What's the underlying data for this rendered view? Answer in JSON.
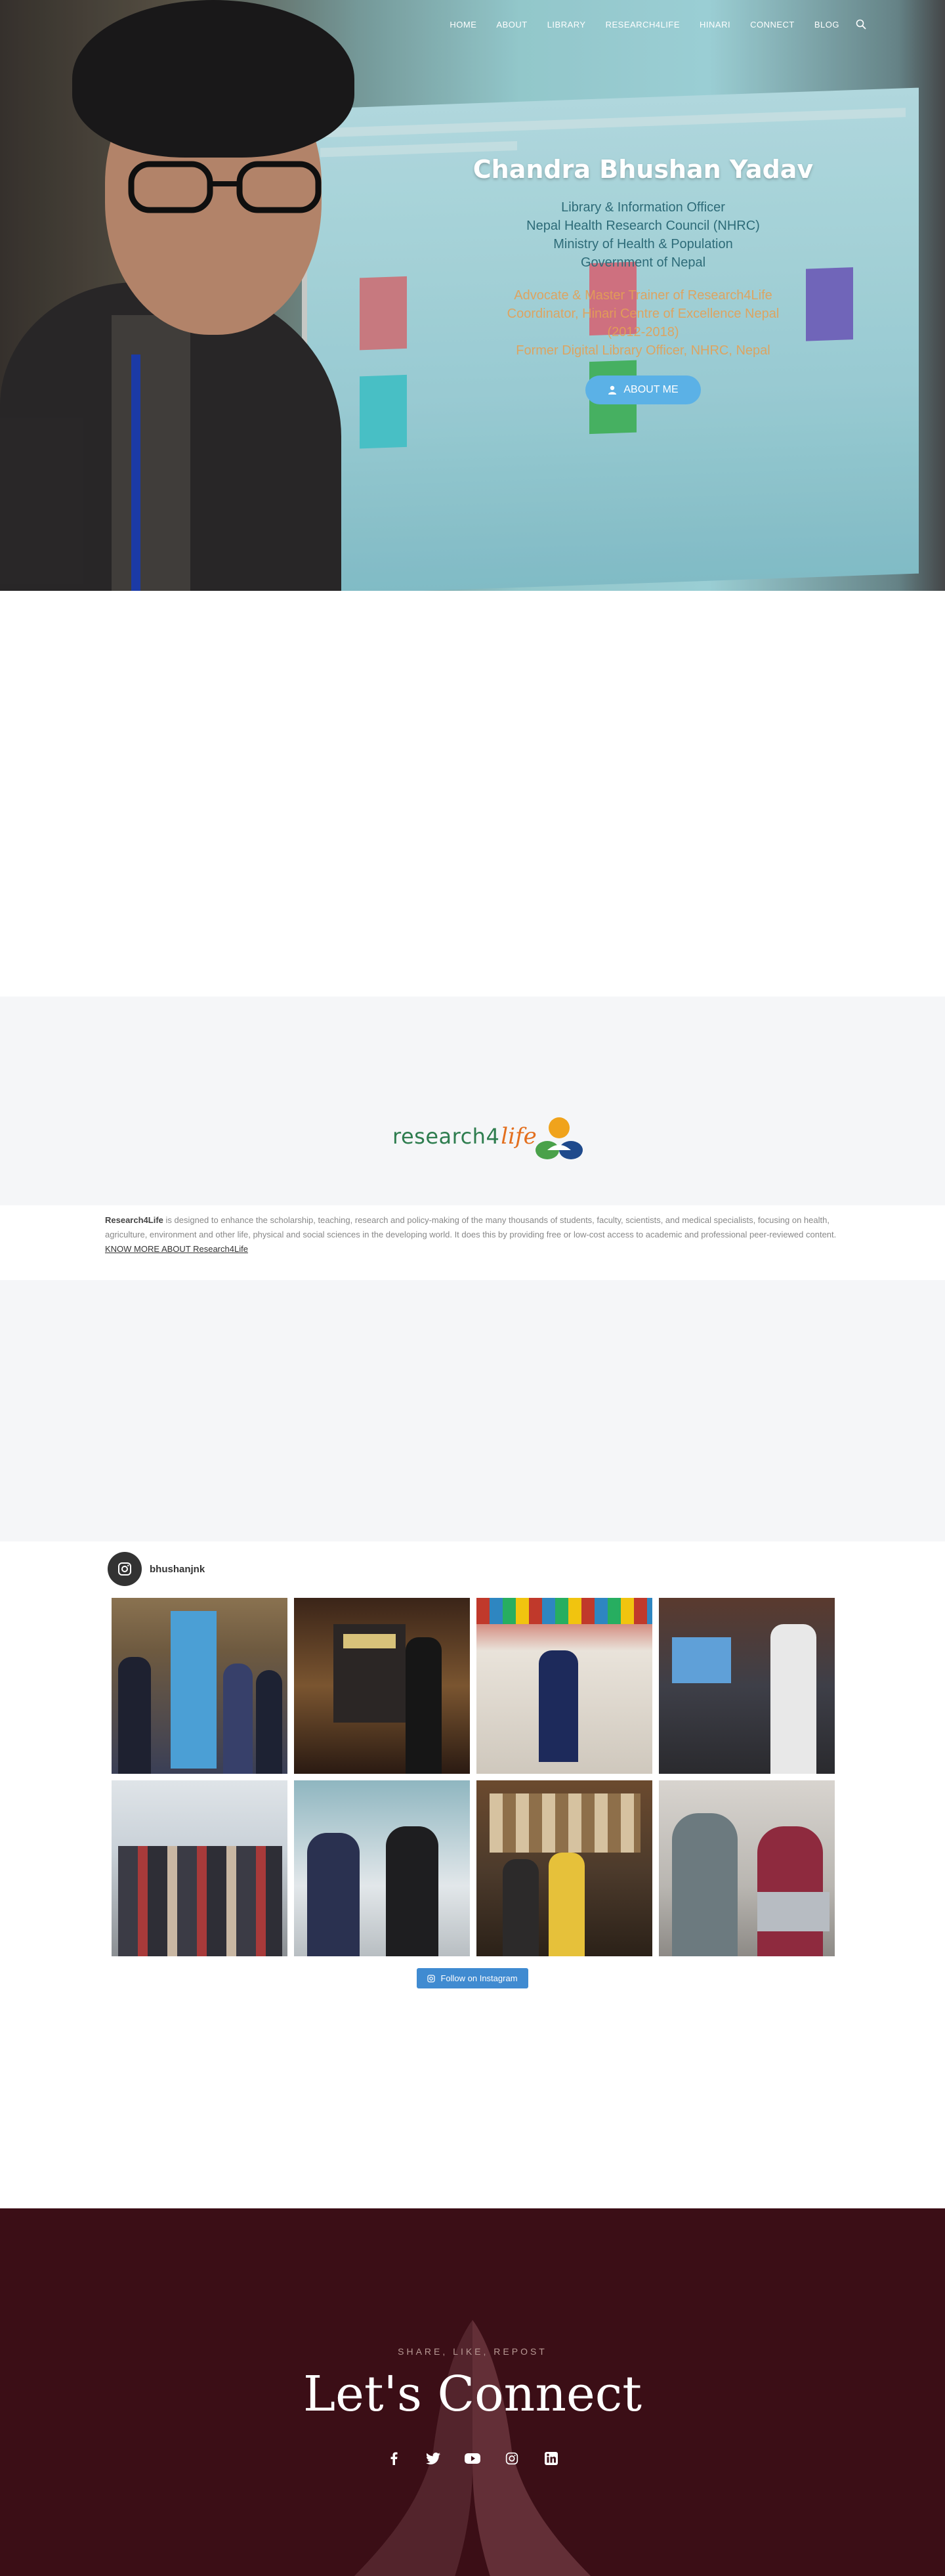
{
  "nav": {
    "items": [
      "HOME",
      "ABOUT",
      "LIBRARY",
      "RESEARCH4LIFE",
      "HINARI",
      "CONNECT",
      "BLOG"
    ]
  },
  "hero": {
    "name": "Chandra Bhushan Yadav",
    "lines": [
      "Library & Information Officer",
      "Nepal Health Research Council (NHRC)",
      "Ministry of Health & Population",
      "Government of Nepal"
    ],
    "orange_lines": [
      "Advocate & Master Trainer of Research4Life",
      "Coordinator, Hinari Centre of Excellence Nepal",
      "(2012-2018)",
      "Former Digital Library Officer, NHRC, Nepal"
    ],
    "button_label": "ABOUT ME"
  },
  "research4life": {
    "logo_part1": "research4",
    "logo_part2": "life",
    "intro_bold": "Research4Life",
    "intro_text": " is designed to enhance the scholarship, teaching, research and policy-making of the many thousands of students, faculty, scientists, and medical specialists, focusing on health, agriculture, environment and other life, physical and social sciences in the developing world. It does this by providing free or low-cost access to academic and professional peer-reviewed content.",
    "know_more": "KNOW MORE ABOUT Research4Life"
  },
  "instagram": {
    "username": "bhushanjnk",
    "follow_label": "Follow on Instagram"
  },
  "footer": {
    "kicker": "SHARE, LIKE, REPOST",
    "title": "Let's Connect",
    "socials": [
      "facebook-icon",
      "twitter-icon",
      "youtube-icon",
      "instagram-icon",
      "linkedin-icon"
    ]
  },
  "colors": {
    "button_blue": "#5bb1e6",
    "follow_blue": "#408bd1",
    "footer_bg": "#3b0e16",
    "hero_role_text": "#2d6b78",
    "hero_orange_text": "#e4a055"
  }
}
